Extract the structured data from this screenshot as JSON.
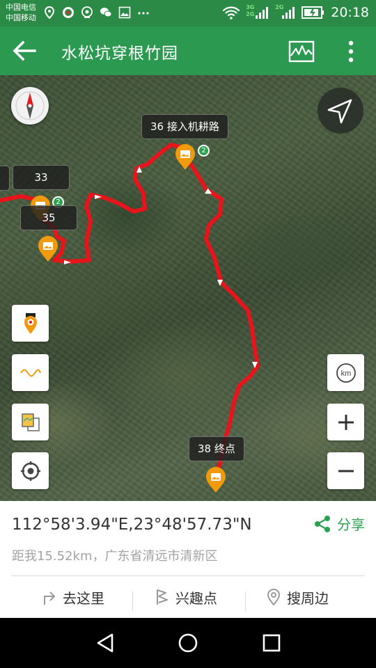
{
  "status_bar": {
    "carrier_1": "中国电信",
    "carrier_2": "中国移动",
    "network_1": "3G",
    "network_2": "2G",
    "time": "20:18"
  },
  "app_bar": {
    "title": "水松坑穿根竹园"
  },
  "map": {
    "waypoints": [
      {
        "label": "33"
      },
      {
        "label": "35"
      },
      {
        "label": "36 接入机耕路"
      },
      {
        "label": "38 终点"
      }
    ],
    "cluster_badge": "2",
    "scale_unit": "km"
  },
  "info": {
    "coordinates": "112°58'3.94\"E,23°48'57.73\"N",
    "distance_text": "距我15.52km，广东省清远市清新区",
    "share_label": "分享"
  },
  "actions": {
    "go_here": "去这里",
    "poi": "兴趣点",
    "nearby": "搜周边"
  },
  "colors": {
    "accent": "#2b9a50",
    "route": "#e8141b",
    "marker": "#f29a0e"
  }
}
